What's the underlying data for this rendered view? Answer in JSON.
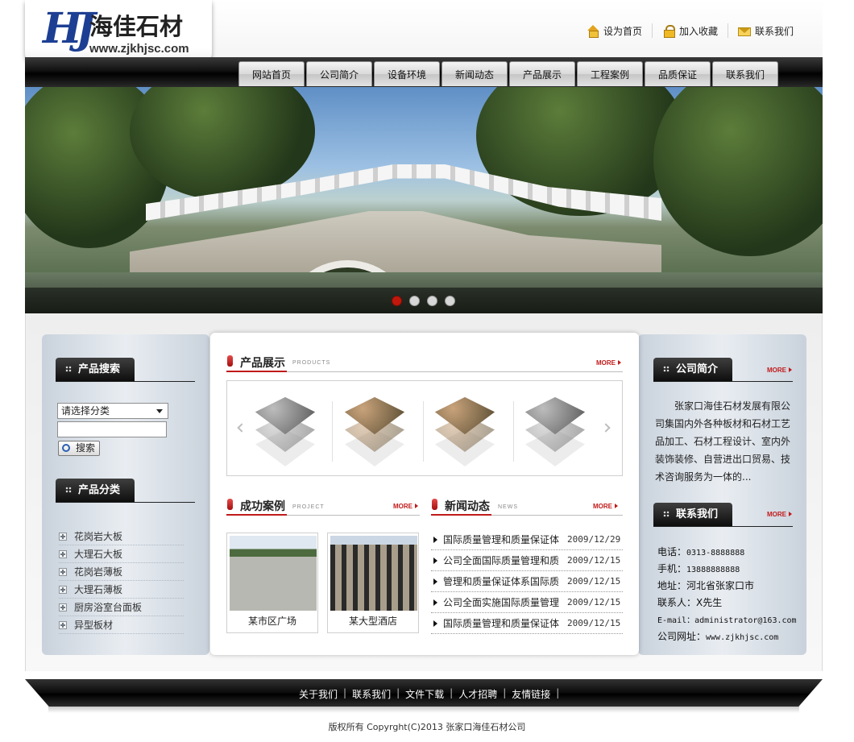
{
  "brand": {
    "logo_mark": "HJ",
    "name": "海佳石材",
    "url": "www.zjkhjsc.com"
  },
  "toplinks": [
    {
      "label": "设为首页",
      "icon": "home-icon"
    },
    {
      "label": "加入收藏",
      "icon": "lock-icon"
    },
    {
      "label": "联系我们",
      "icon": "mail-icon"
    }
  ],
  "nav": [
    "网站首页",
    "公司简介",
    "设备环境",
    "新闻动态",
    "产品展示",
    "工程案例",
    "品质保证",
    "联系我们"
  ],
  "banner": {
    "slide_count": 4,
    "active_slide": 1
  },
  "left": {
    "search_title": "产品搜索",
    "select_value": "请选择分类",
    "keyword_value": "",
    "search_button": "搜索",
    "category_title": "产品分类",
    "categories": [
      "花岗岩大板",
      "大理石大板",
      "花岗岩薄板",
      "大理石薄板",
      "厨房浴室台面板",
      "异型板材"
    ]
  },
  "center": {
    "products": {
      "title": "产品展示",
      "sub": "PRODUCTS",
      "more": "MORE"
    },
    "cases": {
      "title": "成功案例",
      "sub": "PROJECT",
      "more": "MORE",
      "items": [
        {
          "caption": "某市区广场"
        },
        {
          "caption": "某大型酒店"
        }
      ]
    },
    "news": {
      "title": "新闻动态",
      "sub": "NEWS",
      "more": "MORE",
      "items": [
        {
          "title": "国际质量管理和质量保证体",
          "date": "2009/12/29"
        },
        {
          "title": "公司全面国际质量管理和质",
          "date": "2009/12/15"
        },
        {
          "title": "管理和质量保证体系国际质",
          "date": "2009/12/15"
        },
        {
          "title": "公司全面实施国际质量管理",
          "date": "2009/12/15"
        },
        {
          "title": "国际质量管理和质量保证体",
          "date": "2009/12/15"
        }
      ]
    }
  },
  "right": {
    "about_title": "公司简介",
    "about_more": "MORE",
    "about_text": "张家口海佳石材发展有限公司集国内外各种板材和石材工艺品加工、石材工程设计、室内外装饰装修、自营进出口贸易、技术咨询服务为一体的...",
    "contact_title": "联系我们",
    "contact_more": "MORE",
    "contact": [
      {
        "label": "电话：",
        "value": "0313-8888888"
      },
      {
        "label": "手机：",
        "value": "13888888888"
      },
      {
        "label": "地址：",
        "value": "河北省张家口市"
      },
      {
        "label": "联系人：",
        "value": "X先生"
      },
      {
        "label": "E-mail：",
        "value": "administrator@163.com"
      },
      {
        "label": "公司网址：",
        "value": "www.zjkhjsc.com"
      }
    ]
  },
  "footer": {
    "links": [
      "关于我们",
      "联系我们",
      "文件下载",
      "人才招聘",
      "友情链接"
    ],
    "copyright": "版权所有 Copyrght(C)2013 张家口海佳石材公司"
  },
  "colors": {
    "accent_red": "#c01a1a",
    "logo_blue": "#1d3f93",
    "dark_bar": "#111111"
  }
}
